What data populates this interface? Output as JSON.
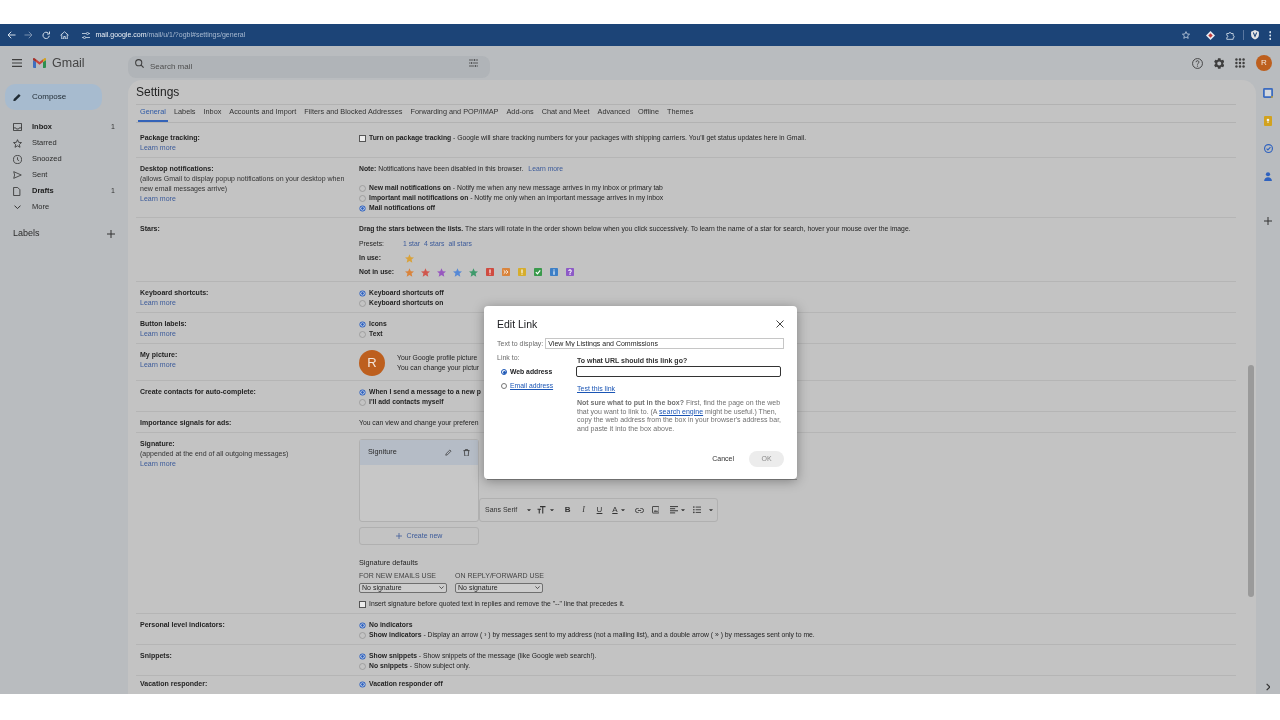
{
  "browser": {
    "url_host": "mail.google.com",
    "url_path": "/mail/u/1/?ogbl#settings/general"
  },
  "header": {
    "app_name": "Gmail",
    "search": {
      "placeholder": "Search mail"
    },
    "avatar_letter": "R"
  },
  "sidebar": {
    "compose": "Compose",
    "items": [
      {
        "label": "Inbox",
        "count": "1",
        "unread": true,
        "selected": false
      },
      {
        "label": "Starred",
        "unread": false,
        "selected": false
      },
      {
        "label": "Snoozed",
        "unread": false,
        "selected": false
      },
      {
        "label": "Sent",
        "unread": false,
        "selected": false
      },
      {
        "label": "Drafts",
        "count": "1",
        "unread": true,
        "selected": false
      },
      {
        "label": "More",
        "unread": false,
        "selected": false
      }
    ],
    "labels_heading": "Labels"
  },
  "settings": {
    "title": "Settings",
    "tabs": [
      {
        "label": "General",
        "selected": true
      },
      {
        "label": "Labels",
        "selected": false
      },
      {
        "label": "Inbox",
        "selected": false
      },
      {
        "label": "Accounts and Import",
        "selected": false
      },
      {
        "label": "Filters and Blocked Addresses",
        "selected": false
      },
      {
        "label": "Forwarding and POP/IMAP",
        "selected": false
      },
      {
        "label": "Add-ons",
        "selected": false
      },
      {
        "label": "Chat and Meet",
        "selected": false
      },
      {
        "label": "Advanced",
        "selected": false
      },
      {
        "label": "Offline",
        "selected": false
      },
      {
        "label": "Themes",
        "selected": false
      }
    ],
    "rows": [
      {
        "label": "Package tracking:",
        "link": "Learn more",
        "content": [
          {
            "kind": "checkbox",
            "title": "Turn on package tracking",
            "text": "- Google will share tracking numbers for your packages with shipping carriers. You'll get status updates here in Gmail.",
            "checked": false
          }
        ]
      },
      {
        "label": "Desktop notifications:",
        "note": "(allows Gmail to display popup notifications on your desktop when new email messages arrive)",
        "link": "Learn more",
        "content": [
          {
            "kind": "note",
            "text": "**Note:** Notifications have been disabled in this browser.",
            "link": "Learn more"
          },
          {
            "kind": "radio",
            "title": "New mail notifications on",
            "text": "- Notify me when any new message arrives in my inbox or primary tab",
            "selected": false
          },
          {
            "kind": "radio",
            "title": "Important mail notifications on",
            "text": "- Notify me only when an important message arrives in my inbox",
            "selected": false
          },
          {
            "kind": "radio",
            "title": "Mail notifications off",
            "selected": true
          }
        ]
      },
      {
        "label": "Stars:",
        "content": [
          {
            "kind": "note",
            "text": "**Drag the stars between the lists.** The stars will rotate in the order shown below when you click successively. To learn the name of a star for search, hover your mouse over the image."
          },
          {
            "kind": "presets",
            "label": "Presets:",
            "links": [
              "1 star",
              "4 stars",
              "all stars"
            ]
          },
          {
            "kind": "star_list",
            "label": "In use:",
            "icons": [
              {
                "kind": "star",
                "color": "#d9a23a"
              }
            ]
          },
          {
            "kind": "star_list",
            "label": "Not in use:",
            "icons": [
              {
                "kind": "star",
                "color": "#d9843c"
              },
              {
                "kind": "star",
                "color": "#d0574e"
              },
              {
                "kind": "star",
                "color": "#9858bf"
              },
              {
                "kind": "star",
                "color": "#5689d6"
              },
              {
                "kind": "star",
                "color": "#3f9a6c"
              },
              {
                "kind": "bang",
                "color": "#cf4b40"
              },
              {
                "kind": "guillemet",
                "color": "#d9843c"
              },
              {
                "kind": "bang",
                "color": "#d6ad2c"
              },
              {
                "kind": "check",
                "color": "#3a9a4c"
              },
              {
                "kind": "info",
                "color": "#3d7fc6"
              },
              {
                "kind": "question",
                "color": "#8d5ac6"
              }
            ]
          }
        ]
      },
      {
        "label": "Keyboard shortcuts:",
        "link": "Learn more",
        "content": [
          {
            "kind": "radio",
            "title": "Keyboard shortcuts off",
            "selected": true
          },
          {
            "kind": "radio",
            "title": "Keyboard shortcuts on",
            "selected": false
          }
        ]
      },
      {
        "label": "Button labels:",
        "link": "Learn more",
        "content": [
          {
            "kind": "radio",
            "title": "Icons",
            "selected": true
          },
          {
            "kind": "radio",
            "title": "Text",
            "selected": false
          }
        ]
      },
      {
        "label": "My picture:",
        "link": "Learn more",
        "content": [
          {
            "kind": "picture",
            "letter": "R",
            "lines": [
              "Your Google profile picture",
              "You can change your pictur"
            ]
          }
        ]
      },
      {
        "label": "Create contacts for auto-complete:",
        "content": [
          {
            "kind": "radio",
            "title": "When I send a message to a new p",
            "selected": true
          },
          {
            "kind": "radio",
            "title": "I'll add contacts myself",
            "selected": false
          }
        ]
      },
      {
        "label": "Importance signals for ads:",
        "content": [
          {
            "kind": "text",
            "text": "You can view and change your preferen"
          }
        ]
      },
      {
        "label": "Signature:",
        "note": "(appended at the end of all outgoing messages)",
        "link": "Learn more",
        "content": [
          {
            "kind": "signature_editor",
            "signatures": [
              {
                "name": "Signiture",
                "selected": true
              }
            ],
            "toolbar": {
              "font": "Sans Serif",
              "format_buttons": [
                "B",
                "I",
                "U"
              ],
              "color_button": "A"
            },
            "create_button": "Create new"
          },
          {
            "kind": "signature_defaults",
            "title": "Signature defaults",
            "selects": [
              {
                "label": "FOR NEW EMAILS USE",
                "value": "No signature"
              },
              {
                "label": "ON REPLY/FORWARD USE",
                "value": "No signature"
              }
            ]
          },
          {
            "kind": "checkbox",
            "text": "Insert signature before quoted text in replies and remove the \"--\" line that precedes it.",
            "checked": false
          }
        ]
      },
      {
        "label": "Personal level indicators:",
        "content": [
          {
            "kind": "radio",
            "title": "No indicators",
            "selected": true
          },
          {
            "kind": "radio",
            "title": "Show indicators",
            "text": "- Display an arrow ( › ) by messages sent to my address (not a mailing list), and a double arrow ( » ) by messages sent only to me.",
            "selected": false
          }
        ]
      },
      {
        "label": "Snippets:",
        "content": [
          {
            "kind": "radio",
            "title": "Show snippets",
            "text": "- Show snippets of the message (like Google web search!).",
            "selected": true
          },
          {
            "kind": "radio",
            "title": "No snippets",
            "text": "- Show subject only.",
            "selected": false
          }
        ]
      },
      {
        "label": "Vacation responder:",
        "content": [
          {
            "kind": "radio",
            "title": "Vacation responder off",
            "selected": true
          }
        ]
      }
    ]
  },
  "dialog": {
    "title": "Edit Link",
    "display_label": "Text to display:",
    "display_value": "View My Listings and Commissions",
    "link_to_label": "Link to:",
    "link_types": [
      {
        "label": "Web address",
        "selected": true
      },
      {
        "label": "Email address",
        "selected": false
      }
    ],
    "url_prompt": "To what URL should this link go?",
    "test_link": "Test this link",
    "help": {
      "before": "**Not sure what to put in the box?** First, find the page on the web that you want to link to. (A ",
      "link": "search engine",
      "after": " might be useful.) Then, copy the web address from the box in your browser's address bar, and paste it into the box above."
    },
    "buttons": [
      {
        "label": "Cancel",
        "kind": "text",
        "disabled": false
      },
      {
        "label": "OK",
        "kind": "filled",
        "disabled": true
      }
    ]
  }
}
